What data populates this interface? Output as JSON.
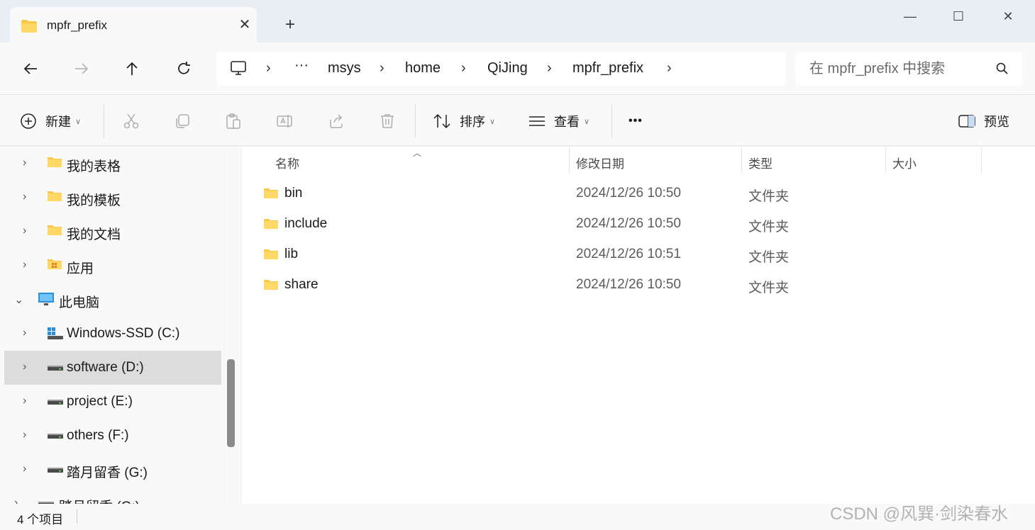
{
  "window": {
    "tab_title": "mpfr_prefix",
    "new_tab_label": "+",
    "minimize": "—",
    "maximize": "☐",
    "close": "✕"
  },
  "breadcrumb": {
    "overflow": "···",
    "items": [
      "msys",
      "home",
      "QiJing",
      "mpfr_prefix"
    ]
  },
  "search": {
    "placeholder": "在 mpfr_prefix 中搜索"
  },
  "toolbar": {
    "new_label": "新建",
    "sort_label": "排序",
    "view_label": "查看",
    "more_label": "•••",
    "preview_label": "预览"
  },
  "sidebar": {
    "items": [
      {
        "label": "我的表格",
        "icon": "folder-icon"
      },
      {
        "label": "我的模板",
        "icon": "folder-icon"
      },
      {
        "label": "我的文档",
        "icon": "folder-icon"
      },
      {
        "label": "应用",
        "icon": "apps-folder-icon"
      },
      {
        "label": "此电脑",
        "icon": "computer-icon"
      },
      {
        "label": "Windows-SSD (C:)",
        "icon": "windows-drive-icon"
      },
      {
        "label": "software (D:)",
        "icon": "drive-icon"
      },
      {
        "label": "project (E:)",
        "icon": "drive-icon"
      },
      {
        "label": "others (F:)",
        "icon": "drive-icon"
      },
      {
        "label": "踏月留香 (G:)",
        "icon": "drive-icon"
      },
      {
        "label": "踏月留香 (G:)",
        "icon": "drive-icon"
      }
    ],
    "selected": "software (D:)"
  },
  "columns": {
    "name": "名称",
    "modified": "修改日期",
    "type": "类型",
    "size": "大小"
  },
  "files": [
    {
      "name": "bin",
      "modified": "2024/12/26 10:50",
      "type": "文件夹"
    },
    {
      "name": "include",
      "modified": "2024/12/26 10:50",
      "type": "文件夹"
    },
    {
      "name": "lib",
      "modified": "2024/12/26 10:51",
      "type": "文件夹"
    },
    {
      "name": "share",
      "modified": "2024/12/26 10:50",
      "type": "文件夹"
    }
  ],
  "status": {
    "item_count": "4 个项目"
  },
  "watermark": "CSDN @风巽·剑染春水",
  "colors": {
    "folder": "#f8c846",
    "accent": "#0067c0"
  }
}
